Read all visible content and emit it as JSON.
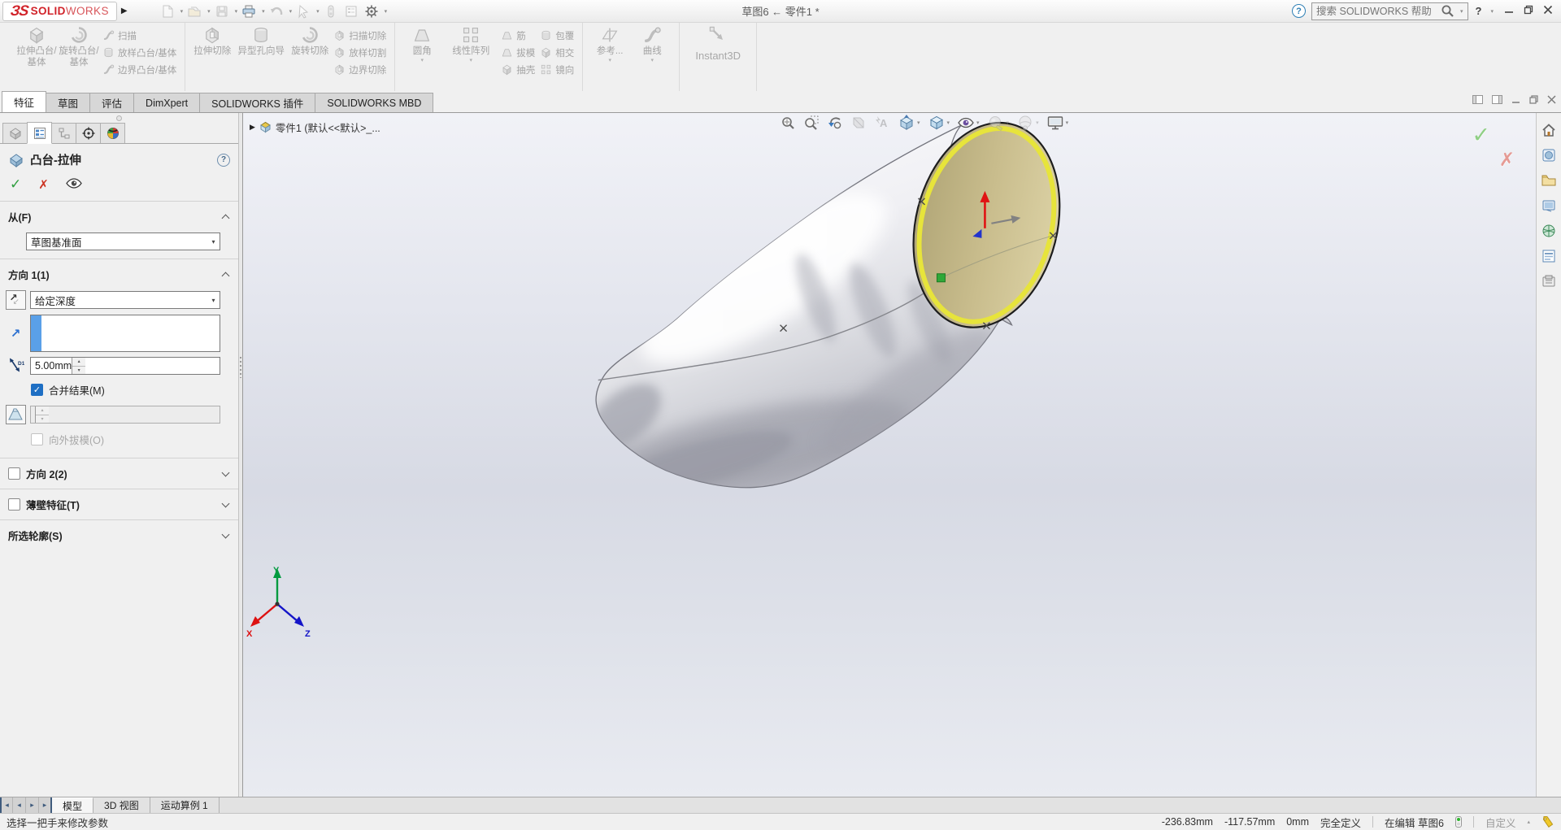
{
  "titlebar": {
    "logo_3s": "ЗS",
    "logo_solid": "SOLID",
    "logo_works": "WORKS",
    "title": "草图6 ← 零件1 *",
    "search_placeholder": "搜索 SOLIDWORKS 帮助",
    "help_glyph": "?"
  },
  "ribbon": {
    "g1": {
      "b1": "拉伸凸台/基体",
      "b2": "旋转凸台/基体",
      "s1": "扫描",
      "s2": "放样凸台/基体",
      "s3": "边界凸台/基体"
    },
    "g2": {
      "b1": "拉伸切除",
      "b2": "异型孔向导",
      "b3": "旋转切除",
      "s1": "扫描切除",
      "s2": "放样切割",
      "s3": "边界切除"
    },
    "g3": {
      "b1": "圆角",
      "b2": "线性阵列",
      "s1": "筋",
      "s2": "拔模",
      "s3": "抽壳",
      "t1": "包覆",
      "t2": "相交",
      "t3": "镜向"
    },
    "g4": {
      "b1": "参考...",
      "b2": "曲线"
    },
    "g5": {
      "b1": "Instant3D"
    }
  },
  "cmdtabs": {
    "t1": "特征",
    "t2": "草图",
    "t3": "评估",
    "t4": "DimXpert",
    "t5": "SOLIDWORKS 插件",
    "t6": "SOLIDWORKS MBD"
  },
  "pm": {
    "title": "凸台-拉伸",
    "from_label": "从(F)",
    "from_value": "草图基准面",
    "dir1_label": "方向 1(1)",
    "end_condition": "给定深度",
    "depth": "5.00mm",
    "merge_label": "合并结果(M)",
    "draft_out_label": "向外拔模(O)",
    "dir2_label": "方向 2(2)",
    "thin_label": "薄壁特征(T)",
    "profiles_label": "所选轮廓(S)"
  },
  "viewport": {
    "doc_label": "零件1  (默认<<默认>_...",
    "axis_x": "X",
    "axis_y": "Y",
    "axis_z": "Z"
  },
  "bottom": {
    "tab1": "模型",
    "tab2": "3D 视图",
    "tab3": "运动算例 1"
  },
  "statusbar": {
    "message": "选择一把手来修改参数",
    "coord_x": "-236.83mm",
    "coord_y": "-117.57mm",
    "coord_z": "0mm",
    "state": "完全定义",
    "editing": "在编辑 草图6",
    "custom": "自定义"
  },
  "glyphs": {
    "flyout": "▶",
    "caret": "▾",
    "caret_up": "▴",
    "ok": "✓",
    "cancel": "✗",
    "close": "✕",
    "minimize": "–",
    "arrow_ne": "↗",
    "arrow_sw": "↙",
    "chevL": "◂",
    "chevR": "▸"
  },
  "colors": {
    "logo_red": "#d1232a",
    "selection_blue": "#5aa0e8",
    "check_green": "#2e9e3e",
    "cancel_red": "#cc3322",
    "face_tan": "#c9bd8d",
    "highlight_yellow": "#e7e43b",
    "merge_check_blue": "#1e6fc4"
  }
}
